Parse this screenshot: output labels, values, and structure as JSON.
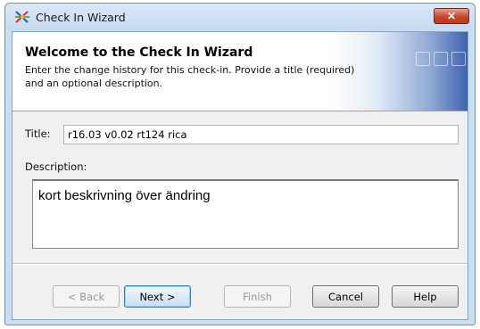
{
  "window": {
    "title": "Check In Wizard",
    "close_label": "✕"
  },
  "header": {
    "title": "Welcome to the Check In Wizard",
    "description": "Enter the change history for this check-in.  Provide a title (required) and an optional description."
  },
  "form": {
    "title_label": "Title:",
    "title_value": "r16.03 v0.02 rt124 rica",
    "description_label": "Description:",
    "description_value": "kort beskrivning över ändring"
  },
  "buttons": {
    "back": "< Back",
    "next": "Next >",
    "finish": "Finish",
    "cancel": "Cancel",
    "help": "Help"
  }
}
